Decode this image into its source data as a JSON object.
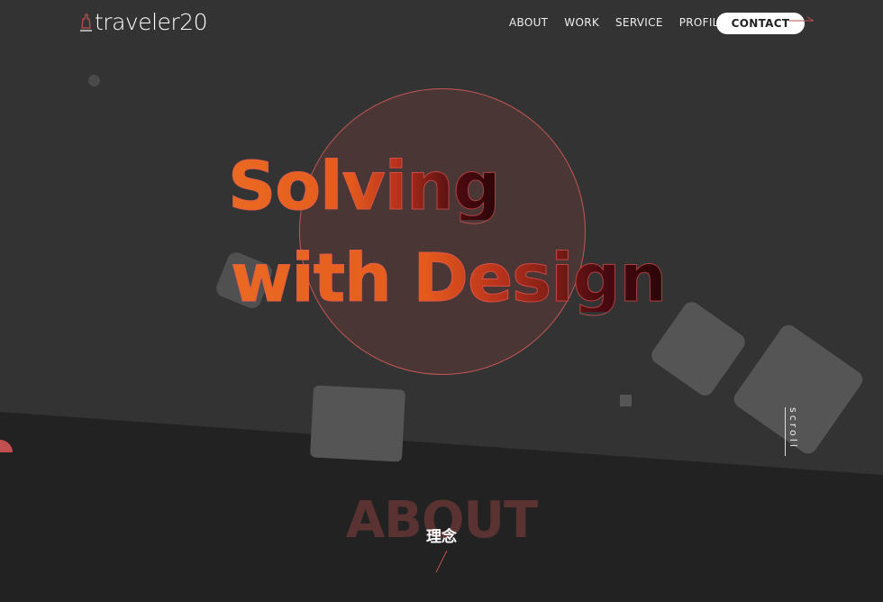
{
  "header": {
    "logo_text": "traveler20",
    "nav": [
      "ABOUT",
      "WORK",
      "SERVICE",
      "PROFILE"
    ],
    "contact_label": "CONTACT"
  },
  "hero": {
    "headline_line1": "Solving",
    "headline_line2": "with Design",
    "scroll_label": "scroll"
  },
  "about": {
    "title": "ABOUT",
    "subtitle": "理念"
  },
  "colors": {
    "background": "#333333",
    "band": "#222222",
    "accent": "#e45a1c",
    "circle_stroke": "#c25656"
  }
}
